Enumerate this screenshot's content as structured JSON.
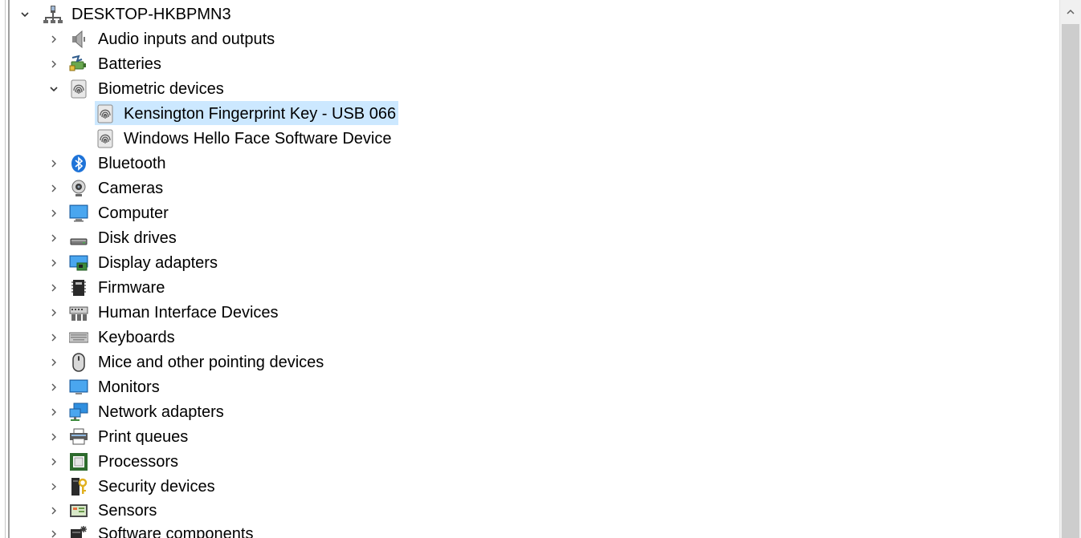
{
  "root": {
    "label": "DESKTOP-HKBPMN3",
    "icon": "computer-network-icon",
    "expanded": true
  },
  "categories": [
    {
      "id": "audio",
      "label": "Audio inputs and outputs",
      "icon": "speaker-icon",
      "expanded": false
    },
    {
      "id": "batteries",
      "label": "Batteries",
      "icon": "battery-icon",
      "expanded": false
    },
    {
      "id": "biometric",
      "label": "Biometric devices",
      "icon": "fingerprint-icon",
      "expanded": true,
      "children": [
        {
          "label": "Kensington Fingerprint Key - USB 066",
          "icon": "fingerprint-icon",
          "selected": true
        },
        {
          "label": "Windows Hello Face Software Device",
          "icon": "fingerprint-icon",
          "selected": false
        }
      ]
    },
    {
      "id": "bluetooth",
      "label": "Bluetooth",
      "icon": "bluetooth-icon",
      "expanded": false
    },
    {
      "id": "cameras",
      "label": "Cameras",
      "icon": "webcam-icon",
      "expanded": false
    },
    {
      "id": "computer",
      "label": "Computer",
      "icon": "monitor-icon",
      "expanded": false
    },
    {
      "id": "disk",
      "label": "Disk drives",
      "icon": "disk-drive-icon",
      "expanded": false
    },
    {
      "id": "display",
      "label": "Display adapters",
      "icon": "display-adapter-icon",
      "expanded": false
    },
    {
      "id": "firmware",
      "label": "Firmware",
      "icon": "chip-icon",
      "expanded": false
    },
    {
      "id": "hid",
      "label": "Human Interface Devices",
      "icon": "hid-icon",
      "expanded": false
    },
    {
      "id": "keyboards",
      "label": "Keyboards",
      "icon": "keyboard-icon",
      "expanded": false
    },
    {
      "id": "mice",
      "label": "Mice and other pointing devices",
      "icon": "mouse-icon",
      "expanded": false
    },
    {
      "id": "monitors",
      "label": "Monitors",
      "icon": "monitor-icon",
      "expanded": false
    },
    {
      "id": "network",
      "label": "Network adapters",
      "icon": "network-adapter-icon",
      "expanded": false
    },
    {
      "id": "print",
      "label": "Print queues",
      "icon": "printer-icon",
      "expanded": false
    },
    {
      "id": "processors",
      "label": "Processors",
      "icon": "processor-icon",
      "expanded": false
    },
    {
      "id": "security",
      "label": "Security devices",
      "icon": "security-key-icon",
      "expanded": false
    },
    {
      "id": "sensors",
      "label": "Sensors",
      "icon": "sensor-icon",
      "expanded": false
    },
    {
      "id": "software",
      "label": "Software components",
      "icon": "software-component-icon",
      "expanded": false
    }
  ],
  "colors": {
    "selection": "#cce8ff",
    "scrollbar_track": "#f0f0f0",
    "scrollbar_thumb": "#cdcdcd"
  }
}
